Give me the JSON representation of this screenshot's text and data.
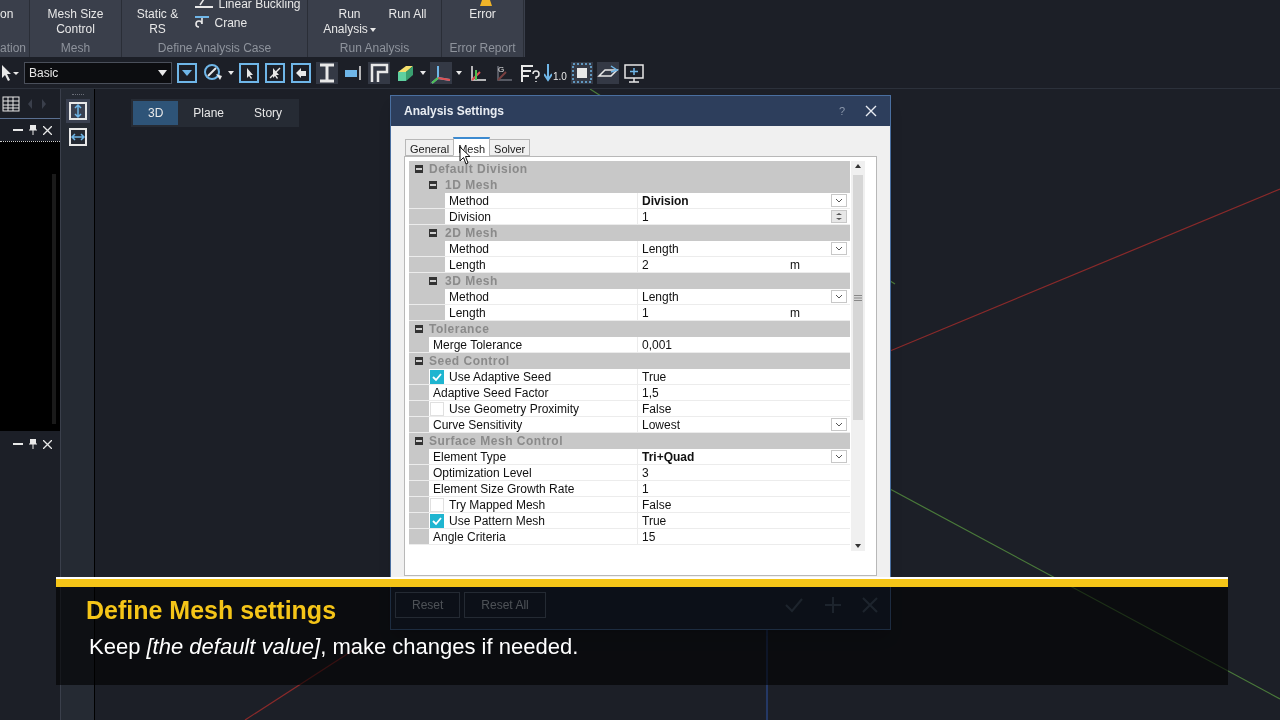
{
  "ribbon": {
    "cut_group": {
      "top": "on",
      "label": "ation"
    },
    "groups": [
      {
        "label": "Mesh",
        "buttons": [
          {
            "label": "Mesh Size Control",
            "kind": "large"
          }
        ]
      },
      {
        "label": "Define Analysis Case",
        "buttons": [
          {
            "label": "Static & RS",
            "kind": "large"
          },
          {
            "label": "Linear Buckling",
            "kind": "small"
          },
          {
            "label": "Crane",
            "kind": "small"
          }
        ]
      },
      {
        "label": "Run Analysis",
        "buttons": [
          {
            "label": "Run Analysis",
            "kind": "dropdown"
          },
          {
            "label": "Run All",
            "kind": "large"
          }
        ]
      },
      {
        "label": "Error Report",
        "buttons": [
          {
            "label": "Error",
            "kind": "large"
          }
        ]
      }
    ]
  },
  "toolbar": {
    "style_select": "Basic",
    "scale_label": "1.0",
    "axis_label": "G"
  },
  "view_tabs": [
    {
      "label": "3D",
      "selected": true
    },
    {
      "label": "Plane",
      "selected": false
    },
    {
      "label": "Story",
      "selected": false
    }
  ],
  "dialog": {
    "title": "Analysis Settings",
    "help": "?",
    "tabs": [
      {
        "label": "General",
        "selected": false
      },
      {
        "label": "Mesh",
        "selected": true
      },
      {
        "label": "Solver",
        "selected": false
      }
    ],
    "grid": [
      {
        "label": "Default Division",
        "expanded": true,
        "children": [
          {
            "kind": "group",
            "label": "1D Mesh",
            "expanded": true,
            "children": [
              {
                "kind": "dropdown",
                "name": "Method",
                "value": "Division",
                "bold": true
              },
              {
                "kind": "spinner",
                "name": "Division",
                "value": "1",
                "bold": false
              }
            ]
          },
          {
            "kind": "group",
            "label": "2D Mesh",
            "expanded": true,
            "children": [
              {
                "kind": "dropdown",
                "name": "Method",
                "value": "Length",
                "bold": false
              },
              {
                "kind": "property",
                "name": "Length",
                "value": "2",
                "unit": "m",
                "bold": false
              }
            ]
          },
          {
            "kind": "group",
            "label": "3D Mesh",
            "expanded": true,
            "children": [
              {
                "kind": "dropdown",
                "name": "Method",
                "value": "Length",
                "bold": false
              },
              {
                "kind": "property",
                "name": "Length",
                "value": "1",
                "unit": "m",
                "bold": false
              }
            ]
          }
        ]
      },
      {
        "label": "Tolerance",
        "expanded": true,
        "children": [
          {
            "kind": "property",
            "name": "Merge Tolerance",
            "value": "0,001",
            "bold": false
          }
        ]
      },
      {
        "label": "Seed Control",
        "expanded": true,
        "children": [
          {
            "kind": "check",
            "name": "Use Adaptive Seed",
            "value": "True",
            "checked": true
          },
          {
            "kind": "property",
            "name": "Adaptive Seed Factor",
            "value": "1,5",
            "bold": false
          },
          {
            "kind": "check",
            "name": "Use Geometry Proximity",
            "value": "False",
            "checked": false
          },
          {
            "kind": "dropdown",
            "name": "Curve Sensitivity",
            "value": "Lowest",
            "bold": false
          }
        ]
      },
      {
        "label": "Surface Mesh Control",
        "expanded": true,
        "children": [
          {
            "kind": "dropdown",
            "name": "Element Type",
            "value": "Tri+Quad",
            "bold": true
          },
          {
            "kind": "property",
            "name": "Optimization Level",
            "value": "3",
            "bold": false
          },
          {
            "kind": "property",
            "name": "Element Size Growth Rate",
            "value": "1",
            "bold": false
          },
          {
            "kind": "check",
            "name": "Try Mapped Mesh",
            "value": "False",
            "checked": false
          },
          {
            "kind": "check",
            "name": "Use Pattern Mesh",
            "value": "True",
            "checked": true
          },
          {
            "kind": "property",
            "name": "Angle Criteria",
            "value": "15",
            "bold": false
          }
        ]
      }
    ],
    "footer_buttons": [
      "Reset",
      "Reset All"
    ]
  },
  "caption": {
    "title": "Define Mesh settings",
    "text": "Keep *[the default value]*, make changes if needed."
  }
}
